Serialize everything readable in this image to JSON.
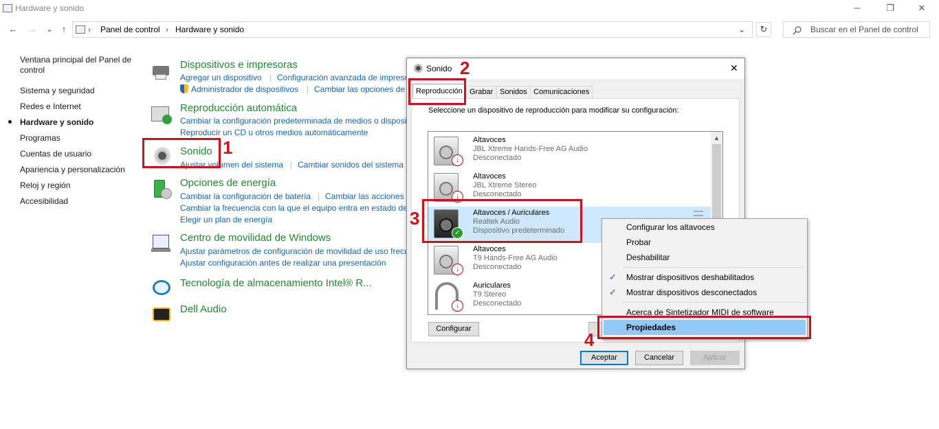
{
  "window": {
    "title": "Hardware y sonido",
    "min_icon": "─",
    "max_icon": "❐",
    "close_icon": "✕"
  },
  "nav": {
    "back": "←",
    "forward": "→",
    "down": "⌄",
    "up": "↑",
    "refresh": "↻",
    "addr_dropdown": "⌄",
    "sep": "›"
  },
  "address": {
    "crumbs": [
      "Panel de control",
      "Hardware y sonido"
    ]
  },
  "search": {
    "placeholder": "Buscar en el Panel de control"
  },
  "left_nav": [
    {
      "label": "Ventana principal del Panel de control"
    },
    {
      "label": "Sistema y seguridad"
    },
    {
      "label": "Redes e Internet"
    },
    {
      "label": "Hardware y sonido",
      "active": true
    },
    {
      "label": "Programas"
    },
    {
      "label": "Cuentas de usuario"
    },
    {
      "label": "Apariencia y personalización"
    },
    {
      "label": "Reloj y región"
    },
    {
      "label": "Accesibilidad"
    }
  ],
  "categories": [
    {
      "title": "Dispositivos e impresoras",
      "links": [
        "Agregar un dispositivo",
        "Configuración avanzada de impreso",
        "Administrador de dispositivos",
        "Cambiar las opciones de"
      ]
    },
    {
      "title": "Reproducción automática",
      "links": [
        "Cambiar la configuración predeterminada de medios o disposi",
        "Reproducir un CD u otros medios automáticamente"
      ]
    },
    {
      "title": "Sonido",
      "links": [
        "Ajustar volumen del sistema",
        "Cambiar sonidos del sistema"
      ]
    },
    {
      "title": "Opciones de energía",
      "links": [
        "Cambiar la configuración de batería",
        "Cambiar las acciones d",
        "Cambiar la frecuencia con la que el equipo entra en estado de",
        "Elegir un plan de energía"
      ]
    },
    {
      "title": "Centro de movilidad de Windows",
      "links": [
        "Ajustar parámetros de configuración de movilidad de uso frecu",
        "Ajustar configuración antes de realizar una presentación"
      ]
    },
    {
      "title": "Tecnología de almacenamiento Intel® R...",
      "links": []
    },
    {
      "title": "Dell Audio",
      "links": []
    }
  ],
  "dialog": {
    "title": "Sonido",
    "close_icon": "✕",
    "tabs": [
      "Reproducción",
      "Grabar",
      "Sonidos",
      "Comunicaciones"
    ],
    "instruction": "Seleccione un dispositivo de reproducción para modificar su configuración:",
    "devices": [
      {
        "name": "Altavoces",
        "desc": "JBL Xtreme Hands-Free AG Audio",
        "status": "Desconectado"
      },
      {
        "name": "Altavoces",
        "desc": "JBL Xtreme Stereo",
        "status": "Desconectado"
      },
      {
        "name": "Altavoces / Auriculares",
        "desc": "Realtek Audio",
        "status": "Dispositivo predeterminado",
        "selected": true
      },
      {
        "name": "Altavoces",
        "desc": "T9 Hands-Free AG Audio",
        "status": "Desconectado"
      },
      {
        "name": "Auriculares",
        "desc": "T9 Stereo",
        "status": "Desconectado"
      }
    ],
    "configure_button": "Configurar",
    "ok_button": "Aceptar",
    "cancel_button": "Cancelar",
    "apply_button": "Aplicar"
  },
  "context_menu": {
    "items": [
      "Configurar los altavoces",
      "Probar",
      "Deshabilitar"
    ],
    "checked_items": [
      "Mostrar dispositivos deshabilitados",
      "Mostrar dispositivos desconectados"
    ],
    "about": "Acerca de Sintetizador MIDI de software",
    "properties": "Propiedades",
    "check_glyph": "✓"
  },
  "annotations": [
    "1",
    "2",
    "3",
    "4"
  ],
  "colors": {
    "link": "#1066b6",
    "category_title": "#1e8a2c",
    "annotation": "#d0101b",
    "selection": "#cde8ff",
    "menu_highlight": "#91c9f7"
  }
}
